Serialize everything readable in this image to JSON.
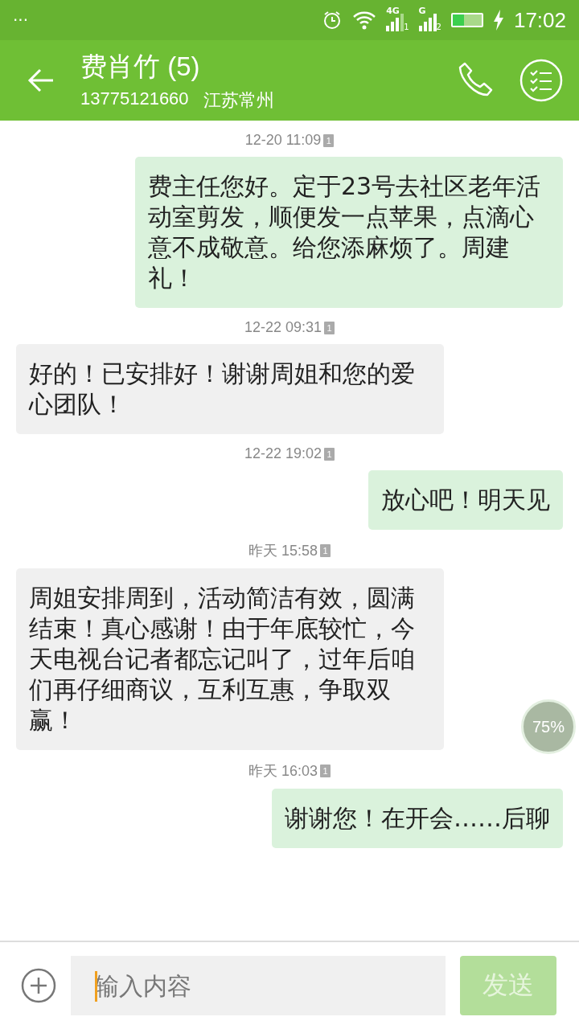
{
  "status_bar": {
    "notification": "···",
    "network_1": "4G",
    "sim_1": "1",
    "network_2": "G",
    "sim_2": "2",
    "time": "17:02"
  },
  "header": {
    "title": "费肖竹 (5)",
    "phone": "13775121660",
    "location": "江苏常州"
  },
  "messages": [
    {
      "time": "12-20 11:09",
      "sim": "1",
      "kind": "sent",
      "text": "费主任您好。定于23号去社区老年活动室剪发，顺便发一点苹果，点滴心意不成敬意。给您添麻烦了。周建礼！"
    },
    {
      "time": "12-22 09:31",
      "sim": "1",
      "kind": "received",
      "text": "好的！已安排好！谢谢周姐和您的爱心团队！"
    },
    {
      "time": "12-22 19:02",
      "sim": "1",
      "kind": "sent",
      "text": "放心吧！明天见"
    },
    {
      "time": "昨天 15:58",
      "sim": "1",
      "kind": "received",
      "text": "周姐安排周到，活动简洁有效，圆满结束！真心感谢！由于年底较忙，今天电视台记者都忘记叫了，过年后咱们再仔细商议，互利互惠，争取双赢！"
    },
    {
      "time": "昨天 16:03",
      "sim": "1",
      "kind": "sent",
      "text": "谢谢您！在开会……后聊"
    }
  ],
  "floating_badge": "75%",
  "composer": {
    "placeholder": "输入内容",
    "send": "发送",
    "send_disabled": true
  }
}
